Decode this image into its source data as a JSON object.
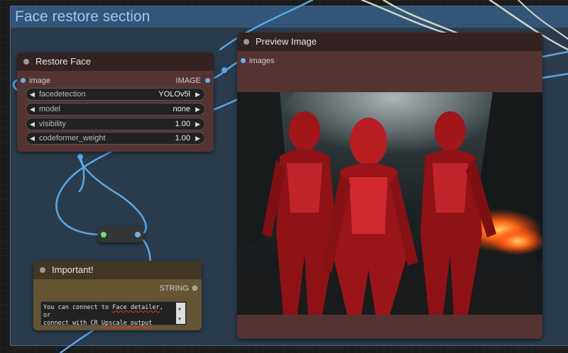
{
  "group": {
    "title": "Face restore section"
  },
  "restore_face": {
    "title": "Restore Face",
    "input_label": "image",
    "output_label": "IMAGE",
    "widgets": [
      {
        "name": "facedetection",
        "value": "YOLOv5l"
      },
      {
        "name": "model",
        "value": "none"
      },
      {
        "name": "visibility",
        "value": "1.00"
      },
      {
        "name": "codeformer_weight",
        "value": "1.00"
      }
    ]
  },
  "preview_image": {
    "title": "Preview Image",
    "input_label": "images",
    "image_description": "three red armored figures in a rocky cave with fire"
  },
  "note": {
    "title": "Important!",
    "output_label": "STRING",
    "text_parts": [
      "You can connect to ",
      "Face detailer",
      ", or\nconnect with CR ",
      "Upscale output"
    ]
  },
  "colors": {
    "wire": "#5aa6e6",
    "node_red": "#553333",
    "node_note": "#665533",
    "group": "#335577"
  }
}
